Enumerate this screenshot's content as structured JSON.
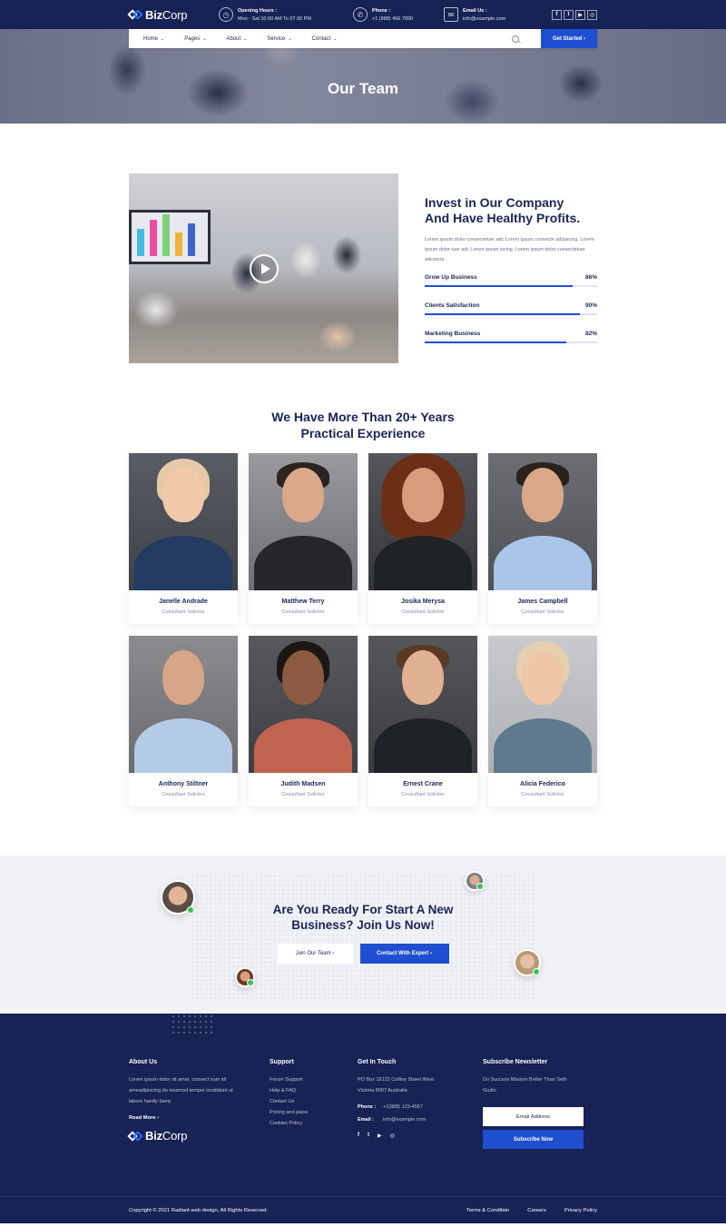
{
  "brand": {
    "name_bold": "Biz",
    "name_light": "Corp"
  },
  "topbar": {
    "hours_label": "Opening Hours :",
    "hours_value": "Mon - Sat 10:00 AM To 07:30 PM",
    "phone_label": "Phone :",
    "phone_value": "+1 (888) 456 7890",
    "email_label": "Email Us :",
    "email_value": "info@example.com",
    "social": [
      "f",
      "t",
      "▶",
      "◎"
    ]
  },
  "nav": {
    "items": [
      "Home",
      "Pages",
      "About",
      "Service",
      "Contact"
    ],
    "cta": "Get Started ›"
  },
  "hero": {
    "title": "Our Team"
  },
  "invest": {
    "title_line1": "Invest in Our Company",
    "title_line2": "And Have Healthy Profits.",
    "text": "Lorem ipsum dolor consectetuer adc Lorem ipsum consecte adipiscing. Lorem ipsum dolor tuer adc Lorem ipsum iscing. Lorem ipsum dolor consectetuer adcsecte.",
    "skills": [
      {
        "label": "Grow Up Business",
        "value": "86%",
        "level": 0.86
      },
      {
        "label": "Clients Satisfaction",
        "value": "90%",
        "level": 0.9
      },
      {
        "label": "Marketing Business",
        "value": "82%",
        "level": 0.82
      }
    ]
  },
  "team": {
    "title_line1": "We Have More Than 20+ Years",
    "title_line2": "Practical Experience",
    "members": [
      {
        "name": "Janelle Andrade",
        "role": "Consultant Solicitor"
      },
      {
        "name": "Matthew Terry",
        "role": "Consultant Solicitor"
      },
      {
        "name": "Josika Merysa",
        "role": "Consultant Solicitor"
      },
      {
        "name": "James Campbell",
        "role": "Consultant Solicitor"
      },
      {
        "name": "Anthony Stiltner",
        "role": "Consultant Solicitor"
      },
      {
        "name": "Judith Madsen",
        "role": "Consultant Solicitor"
      },
      {
        "name": "Ernest Crane",
        "role": "Consultant Solicitor"
      },
      {
        "name": "Alicia Federico",
        "role": "Consultant Solicitor"
      }
    ]
  },
  "cta": {
    "title_line1": "Are You Ready For Start A New",
    "title_line2": "Business? Join Us Now!",
    "btn_join": "Join Our Team ›",
    "btn_contact": "Contact With Expert ›"
  },
  "footer": {
    "about_title": "About Us",
    "about_text": "Lorem ipsum dolor sit amet, consect sum sit ameadipiscing do eiusmod tempor incididunt ut labore hardly damy",
    "read_more": "Read More ›",
    "support_title": "Support",
    "support_links": [
      "Forum Support",
      "Help & FAQ",
      "Contact Us",
      "Pricing and plans",
      "Cookies Policy"
    ],
    "touch_title": "Get In Touch",
    "address": "PO Box 16122 Collins Street West Victoria 8007 Australia",
    "phone_label": "Phone :",
    "phone_value": "+1(888) 123-4567",
    "email_label": "Email :",
    "email_value": "info@example.com",
    "social": [
      "f",
      "t",
      "▶",
      "◎"
    ],
    "newsletter_title": "Subscribe Newsletter",
    "newsletter_text": "Do Success Mission Better Than Seth Godin",
    "email_placeholder": "Email Address",
    "subscribe": "Subscribe Now",
    "copyright": "Copyright © 2021 Radiant web design, All Rights Reserved.",
    "bottom_links": [
      "Terms & Condition",
      "Careers",
      "Privacy Policy"
    ]
  },
  "colors": {
    "navy": "#172255",
    "accent": "#1f4fd0",
    "light_bg": "#f1f2f6"
  }
}
